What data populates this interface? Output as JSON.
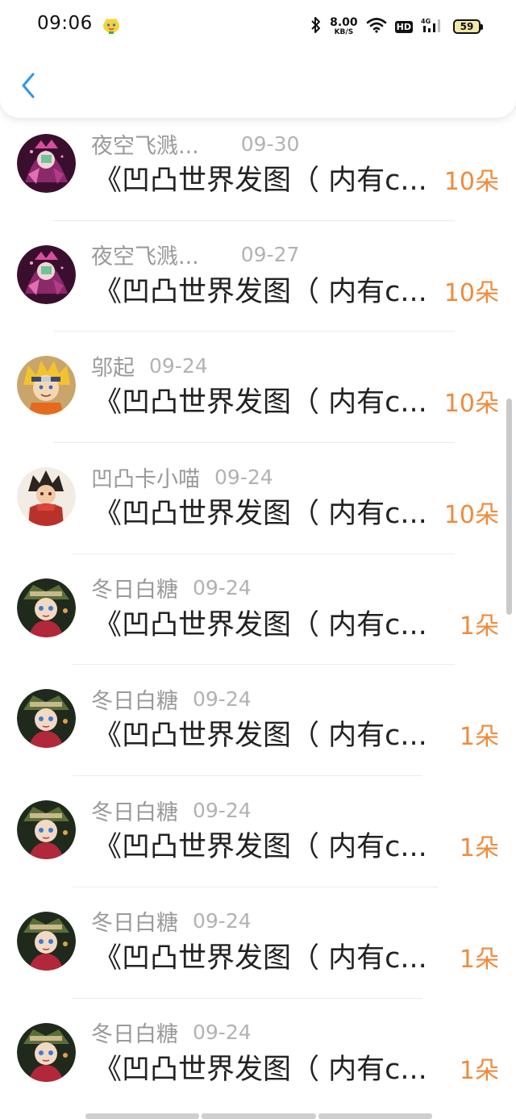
{
  "status_bar": {
    "time": "09:06",
    "net_speed_value": "8.00",
    "net_speed_unit": "KB/S",
    "hd_badge": "HD",
    "signal_label": "4G",
    "battery_level": "59"
  },
  "colors": {
    "accent_blue": "#2f95e8",
    "flower_orange": "#f08a3c",
    "name_gray": "#9a9a9a",
    "date_gray": "#b2b2b2"
  },
  "items": [
    {
      "name": "夜空飞溅...",
      "date": "09-30",
      "title": "《凹凸世界发图（ 内有c...",
      "count": "10朵",
      "avatar": "avatar-dark-pink"
    },
    {
      "name": "夜空飞溅...",
      "date": "09-27",
      "title": "《凹凸世界发图（ 内有c...",
      "count": "10朵",
      "avatar": "avatar-dark-pink"
    },
    {
      "name": "邬起",
      "date": "09-24",
      "title": "《凹凸世界发图（ 内有c...",
      "count": "10朵",
      "avatar": "avatar-ninja"
    },
    {
      "name": "凹凸卡小喵",
      "date": "09-24",
      "title": "《凹凸世界发图（ 内有c...",
      "count": "10朵",
      "avatar": "avatar-red-scarf"
    },
    {
      "name": "冬日白糖",
      "date": "09-24",
      "title": "《凹凸世界发图（ 内有c...",
      "count": "1朵",
      "avatar": "avatar-dark-green"
    },
    {
      "name": "冬日白糖",
      "date": "09-24",
      "title": "《凹凸世界发图（ 内有c...",
      "count": "1朵",
      "avatar": "avatar-dark-green"
    },
    {
      "name": "冬日白糖",
      "date": "09-24",
      "title": "《凹凸世界发图（ 内有c...",
      "count": "1朵",
      "avatar": "avatar-dark-green"
    },
    {
      "name": "冬日白糖",
      "date": "09-24",
      "title": "《凹凸世界发图（ 内有c...",
      "count": "1朵",
      "avatar": "avatar-dark-green"
    },
    {
      "name": "冬日白糖",
      "date": "09-24",
      "title": "《凹凸世界发图（ 内有c...",
      "count": "1朵",
      "avatar": "avatar-dark-green"
    }
  ]
}
